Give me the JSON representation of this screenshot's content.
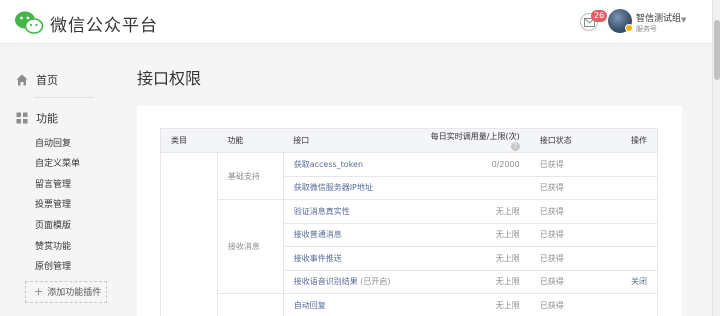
{
  "header": {
    "brand": "微信公众平台",
    "unread_count": "26",
    "account_name": "智信测试组",
    "account_type": "服务号"
  },
  "sidebar": {
    "home_label": "首页",
    "func_label": "功能",
    "sub_items": [
      "自动回复",
      "自定义菜单",
      "留言管理",
      "投票管理",
      "页面模版",
      "赞赏功能",
      "原创管理"
    ],
    "add_plugin_label": "添加功能插件"
  },
  "main": {
    "page_title": "接口权限",
    "columns": {
      "category": "类目",
      "function": "功能",
      "api": "接口",
      "limit": "每日实时调用量/上限(次)",
      "status": "接口状态",
      "operation": "操作"
    },
    "groups": [
      {
        "function": "基础支持",
        "rows": [
          {
            "api": "获取access_token",
            "limit": "0/2000",
            "status": "已获得",
            "op": ""
          },
          {
            "api": "获取微信服务器IP地址",
            "limit": "",
            "status": "已获得",
            "op": ""
          }
        ]
      },
      {
        "function": "接收消息",
        "rows": [
          {
            "api": "验证消息真实性",
            "limit": "无上限",
            "status": "已获得",
            "op": ""
          },
          {
            "api": "接收普通消息",
            "limit": "无上限",
            "status": "已获得",
            "op": ""
          },
          {
            "api": "接收事件推送",
            "limit": "无上限",
            "status": "已获得",
            "op": ""
          },
          {
            "api": "接收语音识别结果",
            "api_suffix": "(已开启)",
            "limit": "无上限",
            "status": "已获得",
            "op": "关闭"
          }
        ]
      },
      {
        "function": "",
        "rows": [
          {
            "api": "自动回复",
            "limit": "无上限",
            "status": "已获得",
            "op": ""
          }
        ]
      }
    ]
  },
  "colors": {
    "link": "#576b95",
    "badge": "#e15f63",
    "brand_green": "#44b549"
  }
}
